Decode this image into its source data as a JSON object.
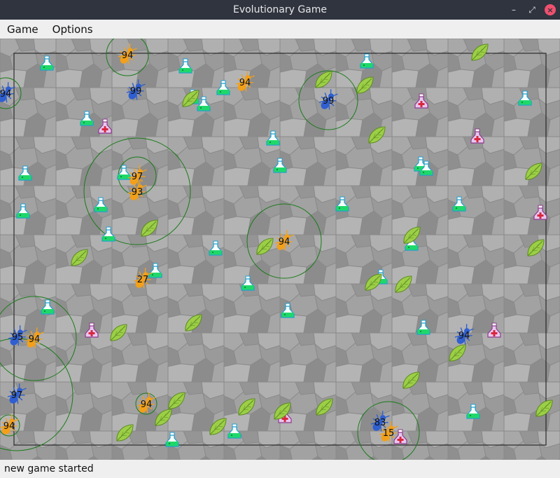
{
  "window": {
    "title": "Evolutionary Game"
  },
  "menu": {
    "game": "Game",
    "options": "Options"
  },
  "status": {
    "message": "new game started"
  },
  "colors": {
    "orange_ant": "#f2a01b",
    "blue_ant": "#2f5fd0",
    "potion_green": "#1fd86a",
    "potion_red": "#d9263c",
    "leaf": "#8fc63f",
    "range_ring": "#1a7a1a"
  },
  "entities": {
    "orange_ants": [
      {
        "label": "94"
      },
      {
        "label": "94"
      },
      {
        "label": "97"
      },
      {
        "label": "93"
      },
      {
        "label": "94"
      },
      {
        "label": "27"
      },
      {
        "label": "94"
      },
      {
        "label": "94"
      },
      {
        "label": "94"
      },
      {
        "label": "15"
      }
    ],
    "blue_ants": [
      {
        "label": "94"
      },
      {
        "label": "99"
      },
      {
        "label": "99"
      },
      {
        "label": "95"
      },
      {
        "label": "94"
      },
      {
        "label": "97"
      },
      {
        "label": "83"
      }
    ]
  }
}
